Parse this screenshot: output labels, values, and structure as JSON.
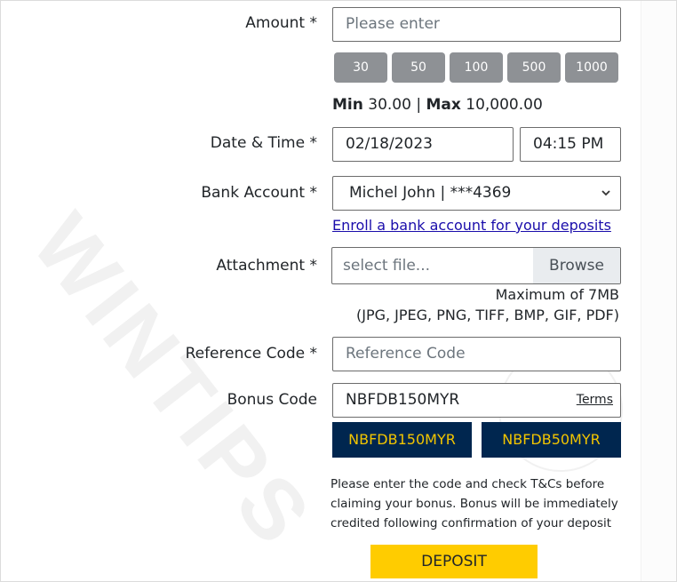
{
  "watermark": "WINTIPS",
  "amount": {
    "label": "Amount *",
    "placeholder": "Please enter",
    "quick_amounts": [
      "30",
      "50",
      "100",
      "500",
      "1000"
    ],
    "min_label": "Min",
    "min_value": "30.00",
    "separator": "|",
    "max_label": "Max",
    "max_value": "10,000.00"
  },
  "datetime": {
    "label": "Date & Time *",
    "date_value": "02/18/2023",
    "time_value": "04:15 PM"
  },
  "bank_account": {
    "label": "Bank Account *",
    "selected": "Michel John | ***4369",
    "enroll_link": "Enroll a bank account for your deposits"
  },
  "attachment": {
    "label": "Attachment *",
    "placeholder": "select file...",
    "browse_label": "Browse",
    "max_size": "Maximum of 7MB",
    "formats": "(JPG, JPEG, PNG, TIFF, BMP, GIF, PDF)"
  },
  "reference_code": {
    "label": "Reference Code *",
    "placeholder": "Reference Code"
  },
  "bonus_code": {
    "label": "Bonus Code",
    "value": "NBFDB150MYR",
    "terms_label": "Terms",
    "options": [
      "NBFDB150MYR",
      "NBFDB50MYR"
    ],
    "note": "Please enter the code and check T&Cs before claiming your bonus. Bonus will be immediately credited following confirmation of your deposit"
  },
  "deposit_label": "DEPOSIT",
  "colors": {
    "bonus_button_bg": "#00264f",
    "bonus_button_text": "#f2c500",
    "deposit_button_bg": "#ffcc00",
    "quick_amount_bg": "#8e9195",
    "link": "#1a0dab"
  }
}
